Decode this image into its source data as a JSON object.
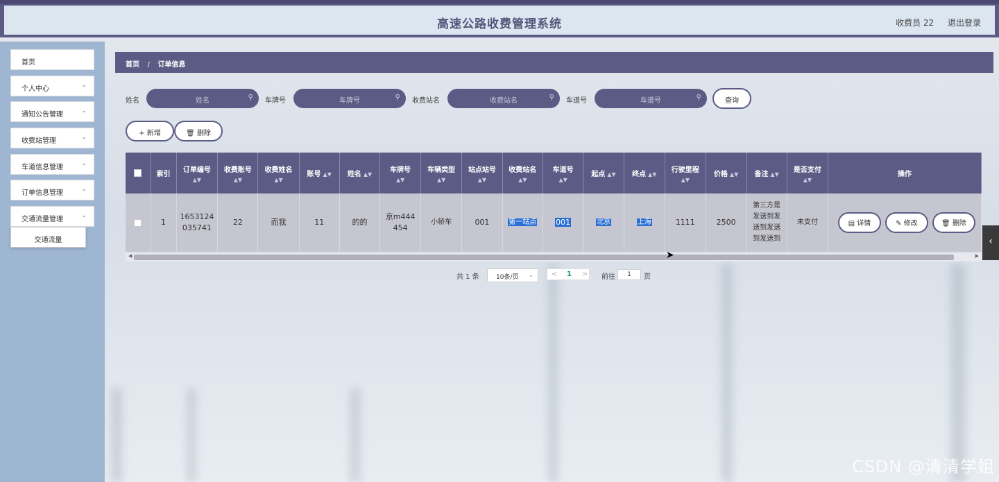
{
  "header": {
    "title": "高速公路收费管理系统",
    "user_label": "收费员 22",
    "logout_label": "退出登录"
  },
  "sidebar": {
    "items": [
      {
        "label": "首页",
        "has_submenu": false
      },
      {
        "label": "个人中心",
        "has_submenu": true
      },
      {
        "label": "通知公告管理",
        "has_submenu": true
      },
      {
        "label": "收费站管理",
        "has_submenu": true
      },
      {
        "label": "车道信息管理",
        "has_submenu": true
      },
      {
        "label": "订单信息管理",
        "has_submenu": true
      },
      {
        "label": "交通流量管理",
        "has_submenu": true
      }
    ],
    "submenu_item": "交通流量"
  },
  "breadcrumb": {
    "home": "首页",
    "separator": "/",
    "current": "订单信息"
  },
  "search": {
    "fields": [
      {
        "label": "姓名",
        "placeholder": "姓名"
      },
      {
        "label": "车牌号",
        "placeholder": "车牌号"
      },
      {
        "label": "收费站名",
        "placeholder": "收费站名"
      },
      {
        "label": "车道号",
        "placeholder": "车道号"
      }
    ],
    "query_label": "查询"
  },
  "actions": {
    "add_label": "新增",
    "delete_label": "删除"
  },
  "table": {
    "columns": [
      "索引",
      "订单编号",
      "收费账号",
      "收费姓名",
      "账号",
      "姓名",
      "车牌号",
      "车辆类型",
      "站点站号",
      "收费站名",
      "车道号",
      "起点",
      "终点",
      "行驶里程",
      "价格",
      "备注",
      "是否支付",
      "操作"
    ],
    "rows": [
      {
        "index": "1",
        "order_no": "1653124035741",
        "order_no_line1": "1653124",
        "order_no_line2": "035741",
        "toll_account": "22",
        "toll_name": "而我",
        "account": "11",
        "name": "的的",
        "plate_line1": "京m444",
        "plate_line2": "454",
        "vehicle_type": "小轿车",
        "station_no": "001",
        "station_name": "第一站点",
        "lane_no": "001",
        "start": "北京",
        "end": "上海",
        "mileage": "1111",
        "price": "2500",
        "remark": "第三方是发送到发送到发送到",
        "remark_line1": "第三方是",
        "remark_line2": "发送到发",
        "remark_line3": "送到发送",
        "remark_line4": "到发送到",
        "paid": "未支付",
        "buttons": {
          "detail": "详情",
          "edit": "修改",
          "delete": "删除"
        }
      }
    ]
  },
  "pagination": {
    "total_label": "共 1 条",
    "page_size": "10条/页",
    "current_page": "1",
    "goto_label": "前往",
    "goto_value": "1",
    "page_suffix": "页"
  },
  "watermark": "CSDN @清清学姐",
  "colors": {
    "primary": "#5b5b85",
    "header_bg": "#dbe6f1",
    "sidebar_bg": "#9fb6d3",
    "row_bg": "#c6c6d0",
    "highlight": "#2a6fd6"
  }
}
